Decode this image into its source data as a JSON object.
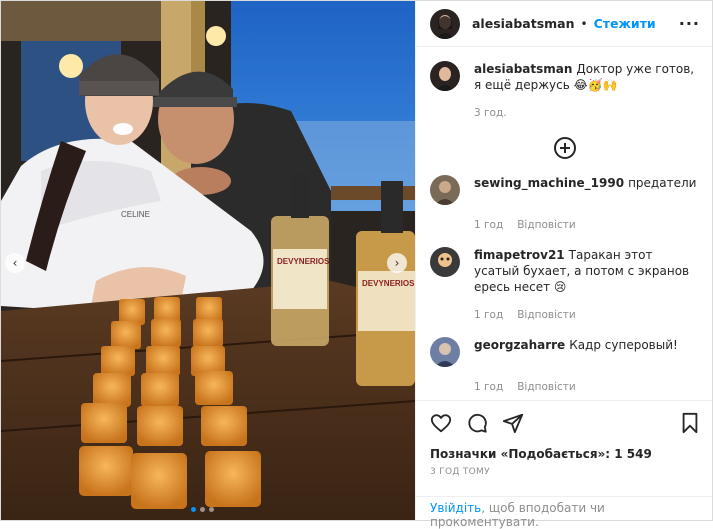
{
  "post_author": {
    "username": "alesiabatsman",
    "follow_label": "Стежити"
  },
  "caption": {
    "username": "alesiabatsman",
    "text": "Доктор уже готов, я ещё держусь 😂🥳🙌",
    "time": "3 год."
  },
  "comments": [
    {
      "username": "sewing_machine_1990",
      "text": "предатели",
      "time": "1 год",
      "reply": "Відповісти"
    },
    {
      "username": "fimapetrov21",
      "text": "Таракан этот усатый бухает, а потом с экранов ересь несет 😢",
      "time": "1 год",
      "reply": "Відповісти"
    },
    {
      "username": "georgzaharre",
      "text": "Кадр суперовый!",
      "time": "1 год",
      "reply": "Відповісти"
    }
  ],
  "likes_text": "Позначки «Подобається»: 1 549",
  "timestamp": "3 ГОД ТОМУ",
  "login_prompt": {
    "link": "Увійдіть",
    "text": ", щоб вподобати чи прокоментувати."
  },
  "photo": {
    "bottle_brand": "DEVYNERIOS",
    "jacket_text": "CELINE"
  },
  "carousel": {
    "count": 3,
    "active": 1
  },
  "colors": {
    "accent": "#0095f6",
    "text": "#262626",
    "muted": "#8e8e8e"
  }
}
